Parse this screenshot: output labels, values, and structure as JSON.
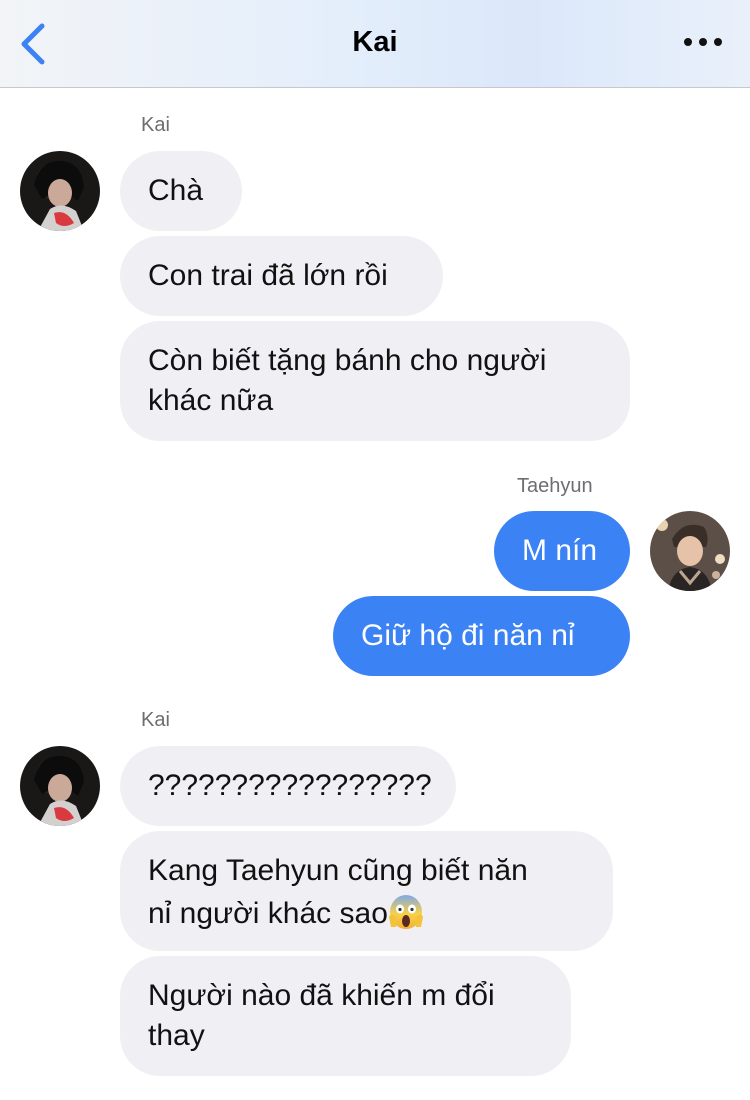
{
  "header": {
    "title": "Kai"
  },
  "groups": [
    {
      "sender": "Kai",
      "messages": [
        "Chà",
        "Con trai đã lớn rồi",
        "Còn biết tặng bánh cho người",
        "khác nữa"
      ]
    },
    {
      "sender": "Taehyun",
      "messages": [
        "M nín",
        "Giữ hộ đi năn nỉ"
      ]
    },
    {
      "sender": "Kai",
      "messages": [
        "?????????????????",
        "Kang Taehyun cũng biết năn",
        "nỉ người khác sao",
        "Người nào đã khiến m đổi",
        "thay"
      ]
    }
  ],
  "icons": {
    "back": "chevron-left-icon",
    "more": "more-horizontal-icon",
    "emoji": "face-screaming-in-fear-emoji"
  },
  "colors": {
    "outgoing_bubble": "#3b82f4",
    "incoming_bubble": "#f0f0f4",
    "back_icon": "#3b82f4"
  }
}
